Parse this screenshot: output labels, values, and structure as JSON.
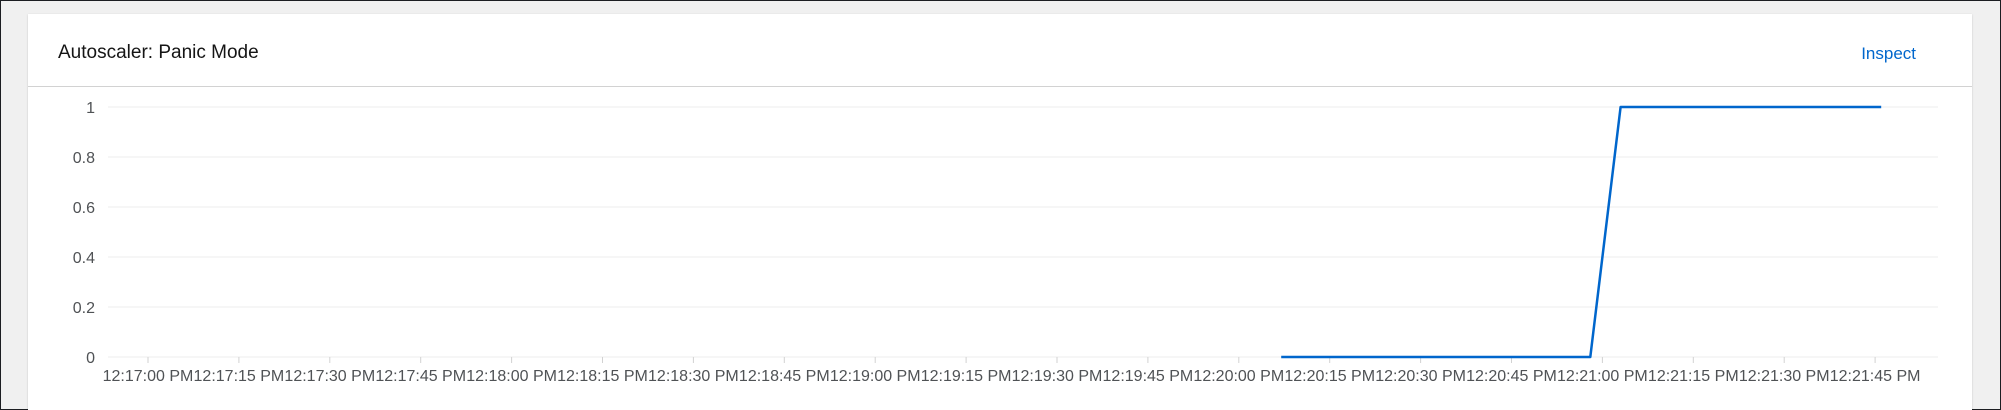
{
  "card": {
    "title": "Autoscaler: Panic Mode",
    "inspect_label": "Inspect"
  },
  "colors": {
    "series": "#0066cc",
    "grid": "#ededed",
    "axis_text": "#4f5255"
  },
  "chart_data": {
    "type": "line",
    "title": "Autoscaler: Panic Mode",
    "xlabel": "",
    "ylabel": "",
    "ylim": [
      0,
      1
    ],
    "yticks": [
      "0",
      "0.2",
      "0.4",
      "0.6",
      "0.8",
      "1"
    ],
    "xticks": [
      "12:17:00 PM",
      "12:17:15 PM",
      "12:17:30 PM",
      "12:17:45 PM",
      "12:18:00 PM",
      "12:18:15 PM",
      "12:18:30 PM",
      "12:18:45 PM",
      "12:19:00 PM",
      "12:19:15 PM",
      "12:19:30 PM",
      "12:19:45 PM",
      "12:20:00 PM",
      "12:20:15 PM",
      "12:20:30 PM",
      "12:20:45 PM",
      "12:21:00 PM",
      "12:21:15 PM",
      "12:21:30 PM",
      "12:21:45 PM"
    ],
    "grid": true,
    "series": [
      {
        "x": [
          "12:20:07 PM",
          "12:20:58 PM",
          "12:21:03 PM",
          "12:21:46 PM"
        ],
        "values": [
          0,
          0,
          1,
          1
        ]
      }
    ]
  }
}
